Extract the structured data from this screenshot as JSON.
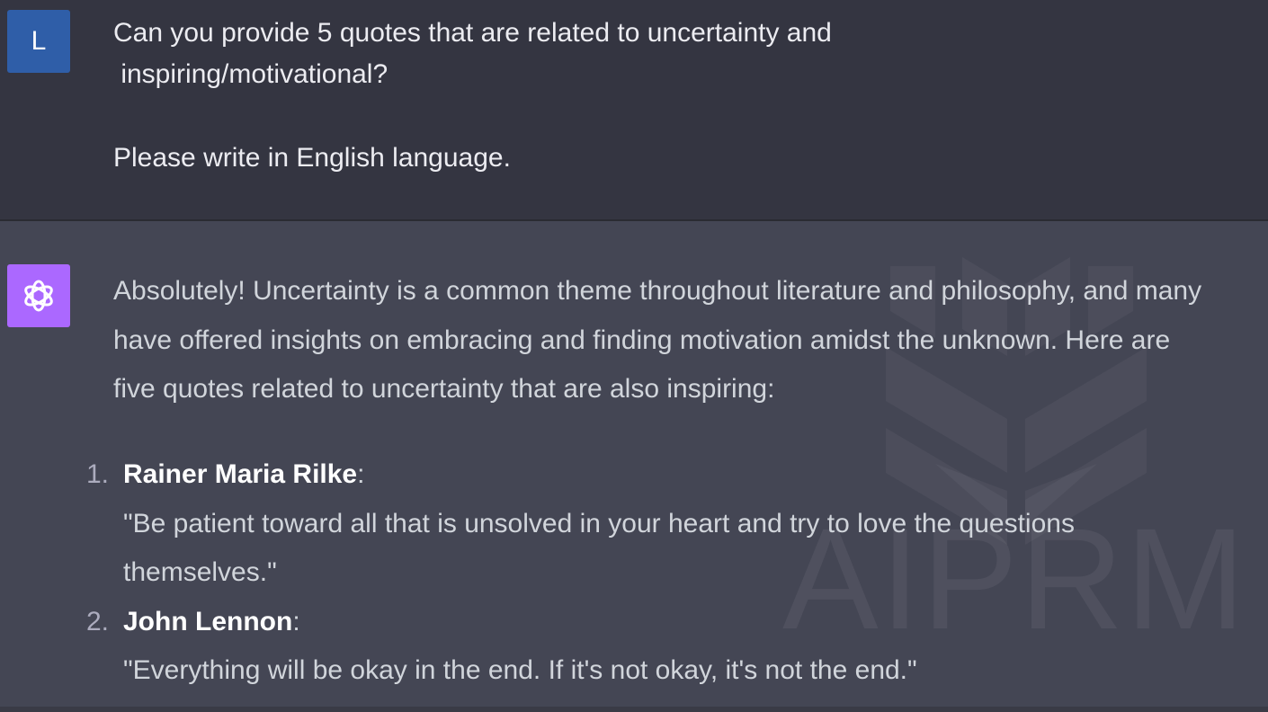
{
  "user": {
    "avatar_letter": "L",
    "line1": "Can you provide 5 quotes that are related to uncertainty and",
    "line2": " inspiring/motivational?",
    "line3": "Please write in English language."
  },
  "assistant": {
    "intro_line1": "Absolutely! Uncertainty is a common theme throughout literature and philosophy, and many",
    "intro_line2": "have offered insights on embracing and finding motivation amidst the unknown. Here are",
    "intro_line3": "five quotes related to uncertainty that are also inspiring:",
    "quotes": [
      {
        "number": "1.",
        "author": "Rainer Maria Rilke",
        "colon": ":",
        "text_line1": "\"Be patient toward all that is unsolved in your heart and try to love the questions",
        "text_line2": "themselves.\""
      },
      {
        "number": "2.",
        "author": "John Lennon",
        "colon": ":",
        "text_line1": "\"Everything will be okay in the end. If it's not okay, it's not the end.\""
      }
    ]
  },
  "watermark": {
    "text": "AIPRM",
    "logo_icon": "aiprm-logo-icon"
  },
  "icons": {
    "bot_avatar": "openai-logo-icon"
  },
  "colors": {
    "user_bg": "#343541",
    "assistant_bg": "#444654",
    "user_avatar": "#2f5ea8",
    "bot_avatar": "#ab68ff"
  }
}
